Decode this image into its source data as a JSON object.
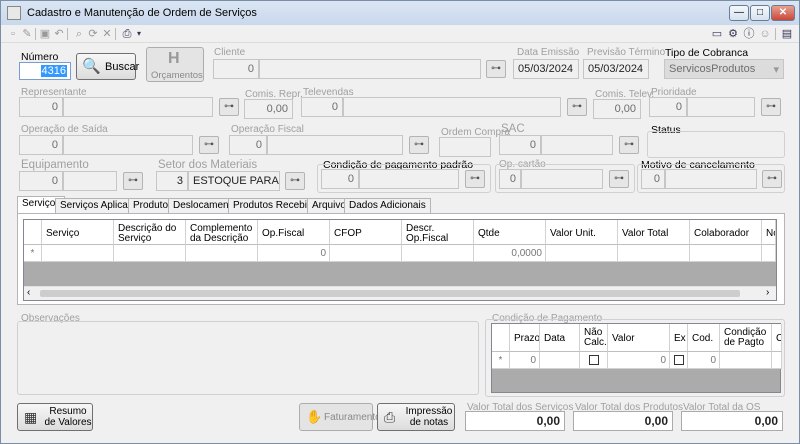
{
  "window": {
    "title": "Cadastro e Manutenção de Ordem de Serviços",
    "buttons": {
      "minimize": "—",
      "maximize": "□",
      "close": "✕"
    }
  },
  "toolbar": {
    "left_icons": [
      "new-icon",
      "edit-icon",
      "save-icon",
      "undo-icon",
      "search-icon",
      "refresh-icon",
      "print-icon",
      "dropdown-icon"
    ],
    "right_icons": [
      "window-icon",
      "settings-icon",
      "info-icon",
      "user-icon",
      "exit-icon"
    ]
  },
  "header": {
    "numero_label": "Número",
    "numero_value": "4316",
    "buscar_label": "Buscar",
    "orcamentos_label": "Orçamentos",
    "cliente_label": "Cliente",
    "cliente_code": "0",
    "data_emissao_label": "Data Emissão",
    "data_emissao_value": "05/03/2024",
    "previsao_label": "Previsão Término",
    "previsao_value": "05/03/2024",
    "tipo_cobranca_label": "Tipo de Cobranca",
    "tipo_cobranca_value": "ServicosProdutos"
  },
  "row2": {
    "representante_label": "Representante",
    "representante_code": "0",
    "comis_repr_label": "Comis. Repr.",
    "comis_repr_value": "0,00",
    "televendas_label": "Televendas",
    "televendas_code": "0",
    "comis_telev_label": "Comis. Telev.",
    "comis_telev_value": "0,00",
    "prioridade_label": "Prioridade",
    "prioridade_value": "0"
  },
  "row3": {
    "operacao_saida_label": "Operação de Saída",
    "operacao_saida_code": "0",
    "operacao_fiscal_label": "Operação Fiscal",
    "operacao_fiscal_code": "0",
    "ordem_compra_label": "Ordem Compra",
    "sac_label": "SAC",
    "sac_value": "0",
    "status_label": "Status"
  },
  "row4": {
    "equipamento_label": "Equipamento",
    "equipamento_code": "0",
    "setor_label": "Setor dos Materiais",
    "setor_code": "3",
    "setor_value": "ESTOQUE PARA O...",
    "condicao_padrao_label": "Condição de pagamento padrão",
    "condicao_padrao_code": "0",
    "op_cartao_label": "Op. cartão",
    "op_cartao_code": "0",
    "motivo_label": "Motivo de cancelamento",
    "motivo_code": "0"
  },
  "tabs": [
    "Serviços",
    "Serviços Aplicados",
    "Produtos",
    "Deslocamentos",
    "Produtos Recebidos",
    "Arquivos",
    "Dados Adicionais"
  ],
  "services_grid": {
    "columns": [
      "Serviço",
      "Descrição do Serviço",
      "Complemento da Descrição",
      "Op.Fiscal",
      "CFOP",
      "Descr. Op.Fiscal",
      "Qtde",
      "Valor Unit.",
      "Valor Total",
      "Colaborador",
      "No"
    ],
    "row_marker": "*",
    "row": [
      "",
      "",
      "",
      "0",
      "",
      "",
      "0,0000",
      "",
      "",
      "",
      ""
    ]
  },
  "observacoes_label": "Observações",
  "payment": {
    "label": "Condição de Pagamento",
    "columns": [
      "Prazo",
      "Data",
      "Não Calc.",
      "Valor",
      "Ex",
      "Cod.",
      "Condição de Pagto",
      "C"
    ],
    "row_marker": "*",
    "row": {
      "prazo": "0",
      "valor": "0",
      "cod": "0"
    }
  },
  "footer": {
    "resumo_label": "Resumo de Valores",
    "faturamento_label": "Faturamento",
    "impressao_label": "Impressão de notas",
    "total_servicos_label": "Valor Total dos Serviços",
    "total_servicos_value": "0,00",
    "total_produtos_label": "Valor Total dos Produtos",
    "total_produtos_value": "0,00",
    "total_os_label": "Valor Total da OS",
    "total_os_value": "0,00"
  }
}
